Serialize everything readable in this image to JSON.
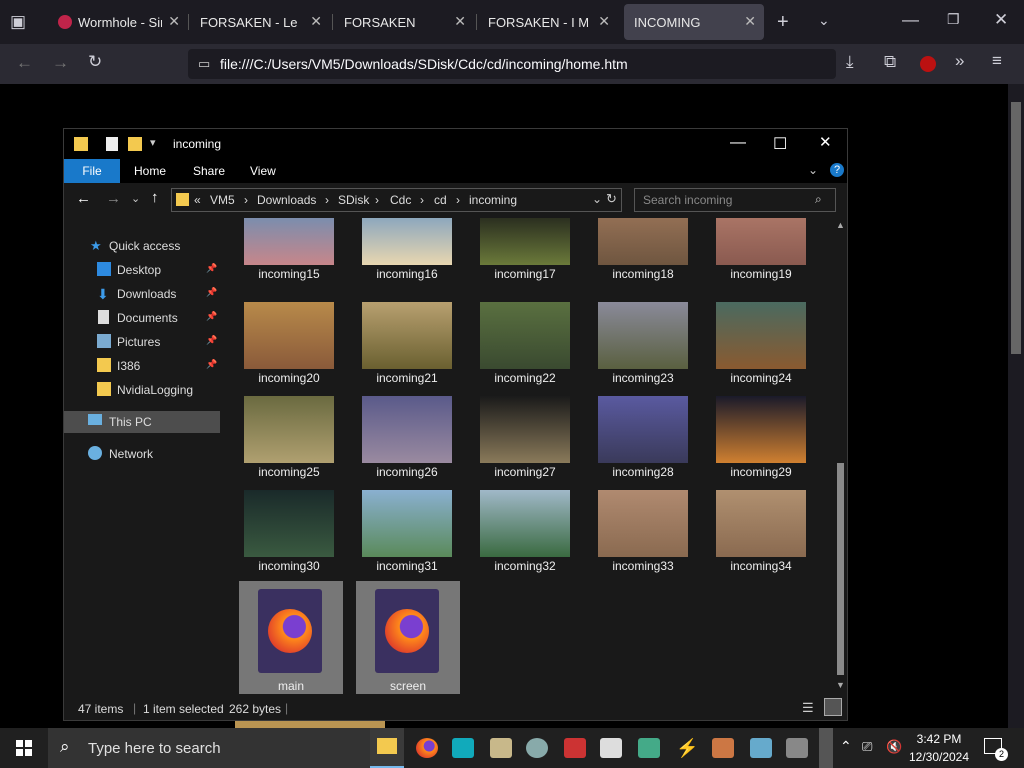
{
  "browser": {
    "tabs": [
      {
        "title": "Wormhole - Sim"
      },
      {
        "title": "FORSAKEN - Le Arm"
      },
      {
        "title": "FORSAKEN"
      },
      {
        "title": "FORSAKEN - I Mezzi"
      },
      {
        "title": "INCOMING"
      }
    ],
    "url": "file:///C:/Users/VM5/Downloads/SDisk/Cdc/cd/incoming/home.htm"
  },
  "explorer": {
    "title": "incoming",
    "ribbon": {
      "file": "File",
      "home": "Home",
      "share": "Share",
      "view": "View"
    },
    "breadcrumb": [
      "«",
      "VM5",
      "Downloads",
      "SDisk",
      "Cdc",
      "cd",
      "incoming"
    ],
    "search_placeholder": "Search incoming",
    "nav": {
      "quick_access": "Quick access",
      "items": [
        "Desktop",
        "Downloads",
        "Documents",
        "Pictures",
        "I386",
        "NvidiaLogging"
      ],
      "this_pc": "This PC",
      "network": "Network"
    },
    "files": [
      {
        "name": "incoming15",
        "colors": [
          "#6b8fb5",
          "#c7868a"
        ]
      },
      {
        "name": "incoming16",
        "colors": [
          "#7a9dc0",
          "#e8d6b0"
        ]
      },
      {
        "name": "incoming17",
        "colors": [
          "#1d1f1a",
          "#6b7a3a"
        ]
      },
      {
        "name": "incoming18",
        "colors": [
          "#9a7458",
          "#6f5640"
        ]
      },
      {
        "name": "incoming19",
        "colors": [
          "#b07a6a",
          "#8a5a50"
        ]
      },
      {
        "name": "incoming20",
        "colors": [
          "#b88a4a",
          "#8a5a3a"
        ]
      },
      {
        "name": "incoming21",
        "colors": [
          "#b8a070",
          "#6a6030"
        ]
      },
      {
        "name": "incoming22",
        "colors": [
          "#5a7040",
          "#3a4a30"
        ]
      },
      {
        "name": "incoming23",
        "colors": [
          "#8a8a9a",
          "#5a6040"
        ]
      },
      {
        "name": "incoming24",
        "colors": [
          "#4a6a60",
          "#8a5a30"
        ]
      },
      {
        "name": "incoming25",
        "colors": [
          "#6a6a40",
          "#b0a070"
        ]
      },
      {
        "name": "incoming26",
        "colors": [
          "#5a5a8a",
          "#9a8aa0"
        ]
      },
      {
        "name": "incoming27",
        "colors": [
          "#1a1a1a",
          "#8a7a5a"
        ]
      },
      {
        "name": "incoming28",
        "colors": [
          "#5a5aa0",
          "#3a3a5a"
        ]
      },
      {
        "name": "incoming29",
        "colors": [
          "#1a1a2a",
          "#d08030"
        ]
      },
      {
        "name": "incoming30",
        "colors": [
          "#1a2a2a",
          "#3a5a40"
        ]
      },
      {
        "name": "incoming31",
        "colors": [
          "#8ab0d0",
          "#5a8a5a"
        ]
      },
      {
        "name": "incoming32",
        "colors": [
          "#a0b8c8",
          "#3a6a40"
        ]
      },
      {
        "name": "incoming33",
        "colors": [
          "#b08a70",
          "#8a6a50"
        ]
      },
      {
        "name": "incoming34",
        "colors": [
          "#b09070",
          "#8a6a50"
        ]
      }
    ],
    "big_files": [
      {
        "name": "main"
      },
      {
        "name": "screen"
      }
    ],
    "status": {
      "items": "47 items",
      "selected": "1 item selected",
      "size": "262 bytes"
    }
  },
  "taskbar": {
    "search_placeholder": "Type here to search",
    "time": "3:42 PM",
    "date": "12/30/2024",
    "notifications": "2"
  }
}
